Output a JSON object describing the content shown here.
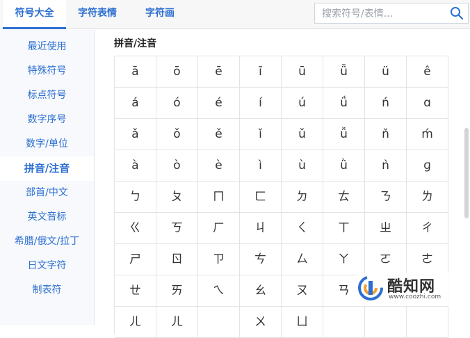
{
  "tabs": [
    {
      "label": "符号大全",
      "active": true
    },
    {
      "label": "字符表情",
      "active": false
    },
    {
      "label": "字符画",
      "active": false
    }
  ],
  "search": {
    "placeholder": "搜索符号/表情...",
    "value": ""
  },
  "sidebar": {
    "items": [
      {
        "label": "最近使用",
        "active": false
      },
      {
        "label": "特殊符号",
        "active": false
      },
      {
        "label": "标点符号",
        "active": false
      },
      {
        "label": "数字序号",
        "active": false
      },
      {
        "label": "数字/单位",
        "active": false
      },
      {
        "label": "拼音/注音",
        "active": true
      },
      {
        "label": "部首/中文",
        "active": false
      },
      {
        "label": "英文音标",
        "active": false
      },
      {
        "label": "希腊/俄文/拉丁",
        "active": false
      },
      {
        "label": "日文字符",
        "active": false
      },
      {
        "label": "制表符",
        "active": false
      }
    ]
  },
  "section": {
    "title": "拼音/注音"
  },
  "symbols": [
    [
      "ā",
      "ō",
      "ē",
      "ī",
      "ū",
      "ǖ",
      "ü",
      "ê"
    ],
    [
      "á",
      "ó",
      "é",
      "í",
      "ú",
      "ǘ",
      "ń",
      "ɑ"
    ],
    [
      "ǎ",
      "ǒ",
      "ě",
      "ǐ",
      "ǔ",
      "ǚ",
      "ň",
      "ḿ"
    ],
    [
      "à",
      "ò",
      "è",
      "ì",
      "ù",
      "ǜ",
      "ǹ",
      "ɡ"
    ],
    [
      "ㄅ",
      "ㄆ",
      "ㄇ",
      "ㄈ",
      "ㄉ",
      "ㄊ",
      "ㄋ",
      "ㄌ"
    ],
    [
      "ㄍ",
      "ㄎ",
      "ㄏ",
      "ㄐ",
      "ㄑ",
      "ㄒ",
      "ㄓ",
      "ㄔ"
    ],
    [
      "ㄕ",
      "ㄖ",
      "ㄗ",
      "ㄘ",
      "ㄙ",
      "ㄚ",
      "ㄛ",
      "ㄜ"
    ],
    [
      "ㄝ",
      "ㄞ",
      "ㄟ",
      "ㄠ",
      "ㄡ",
      "ㄢ",
      "",
      ""
    ],
    [
      "ㄦ",
      "ㄦ",
      "",
      "ㄨ",
      "ㄩ",
      "",
      "",
      ""
    ]
  ],
  "watermark": {
    "name": "酷知网",
    "url": "www.coozhi.com"
  },
  "colors": {
    "accent": "#2c6fd1",
    "grid_border": "#e3e3e3",
    "sidebar_bg": "#f7f9fc"
  },
  "icons": {
    "search": "search-icon",
    "watermark_logo": "coozhi-logo-icon"
  }
}
